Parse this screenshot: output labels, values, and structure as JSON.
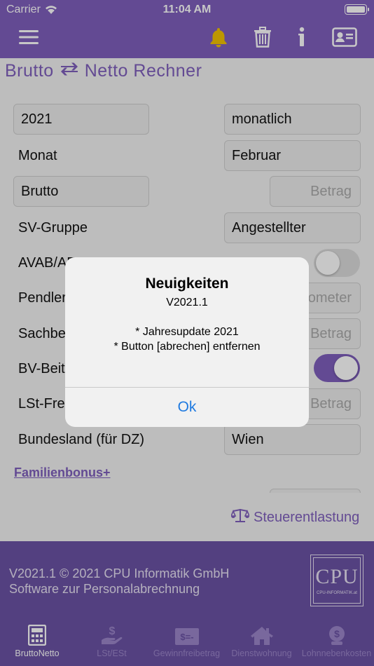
{
  "status_bar": {
    "carrier": "Carrier",
    "time": "11:04 AM"
  },
  "nav": {
    "icons": [
      "menu-icon",
      "bell-icon",
      "trash-icon",
      "info-icon",
      "contact-card-icon"
    ],
    "accent": "#7f5fbd",
    "bell_color": "#f2c200"
  },
  "title": {
    "left": "Brutto",
    "right": "Netto Rechner"
  },
  "form": {
    "year": "2021",
    "period": "monatlich",
    "month_label": "Monat",
    "month_value": "Februar",
    "type_value": "Brutto",
    "amount_placeholder": "Betrag",
    "sv_label": "SV-Gruppe",
    "sv_value": "Angestellter",
    "avab_label": "AVAB/AE",
    "pendler_label": "Pendler",
    "pendler_placeholder": "ometer",
    "sachbezug_label": "Sachbe",
    "sachbezug_placeholder": "Betrag",
    "bv_label": "BV-Beit",
    "lst_label": "LSt-Fre",
    "lst_placeholder": "Betrag",
    "bundesland_label": "Bundesland (für DZ)",
    "bundesland_value": "Wien",
    "familienbonus_link": "Familienbonus+",
    "steuerentlastung": "Steuerentlastung",
    "toggles": {
      "avab": false,
      "bv": true
    }
  },
  "alert": {
    "title": "Neuigkeiten",
    "version": "V2021.1",
    "line1": "* Jahresupdate 2021",
    "line2": "* Button [abrechen] entfernen",
    "ok": "Ok"
  },
  "footer": {
    "line1": "V2021.1 © 2021 CPU Informatik GmbH",
    "line2": "Software zur Personalabrechnung",
    "logo_text": "CPU",
    "logo_sub": "CPU-INFORMATIK.at"
  },
  "tabs": [
    {
      "label": "BruttoNetto",
      "icon": "calculator-icon",
      "active": true
    },
    {
      "label": "LSt/ESt",
      "icon": "hand-dollar-icon",
      "active": false
    },
    {
      "label": "Gewinnfreibetrag",
      "icon": "banknote-icon",
      "active": false
    },
    {
      "label": "Dienstwohnung",
      "icon": "house-icon",
      "active": false
    },
    {
      "label": "Lohnnebenkosten",
      "icon": "money-bag-icon",
      "active": false
    }
  ]
}
